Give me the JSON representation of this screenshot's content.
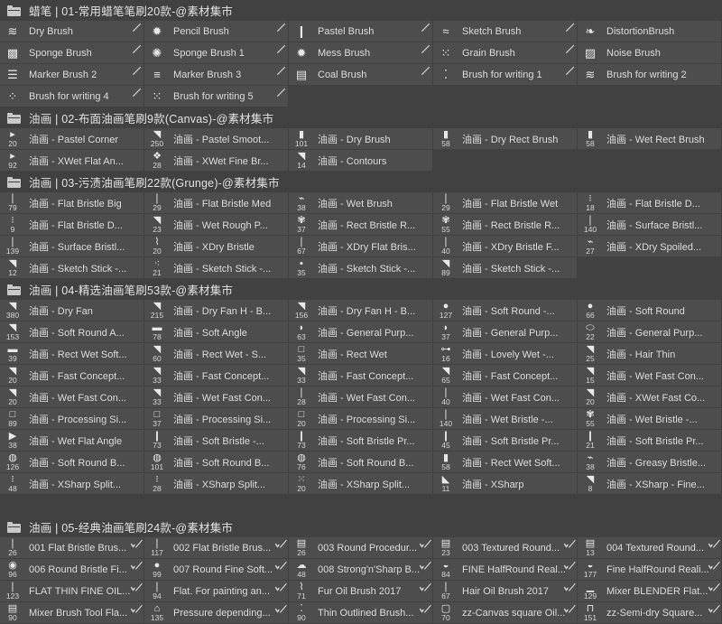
{
  "panel": {
    "title": "Brush Presets Panel",
    "background_color": "#414141",
    "item_color": "#4d4d4d",
    "text_color": "#dcdcdc"
  },
  "groups": [
    {
      "name": "group-crayon",
      "header": "蜡笔 | 01-常用蜡笔笔刷20款-@素材集市",
      "icon": "folder-icon",
      "thumb_style": "big",
      "items": [
        {
          "label": "Dry Brush",
          "glyph": "≋",
          "size": "",
          "corner": "pencil"
        },
        {
          "label": "Pencil Brush",
          "glyph": "✹",
          "size": "",
          "corner": "pencil"
        },
        {
          "label": "Pastel Brush",
          "glyph": "❙",
          "size": "",
          "corner": "pencil"
        },
        {
          "label": "Sketch Brush",
          "glyph": "≈",
          "size": "",
          "corner": "pencil"
        },
        {
          "label": "DistortionBrush",
          "glyph": "❧",
          "size": "",
          "corner": "none"
        },
        {
          "label": "Sponge Brush",
          "glyph": "▩",
          "size": "",
          "corner": "pencil"
        },
        {
          "label": "Sponge Brush 1",
          "glyph": "✺",
          "size": "",
          "corner": "pencil"
        },
        {
          "label": "Mess Brush",
          "glyph": "✹",
          "size": "",
          "corner": "pencil"
        },
        {
          "label": "Grain Brush",
          "glyph": "⁙",
          "size": "",
          "corner": "pencil"
        },
        {
          "label": "Noise Brush",
          "glyph": "▨",
          "size": "",
          "corner": "none"
        },
        {
          "label": "Marker Brush 2",
          "glyph": "☰",
          "size": "",
          "corner": "pencil"
        },
        {
          "label": "Marker Brush 3",
          "glyph": "≡",
          "size": "",
          "corner": "pencil"
        },
        {
          "label": "Coal Brush",
          "glyph": "▤",
          "size": "",
          "corner": "pencil"
        },
        {
          "label": "Brush for writing 1",
          "glyph": "⁚",
          "size": "",
          "corner": "pencil"
        },
        {
          "label": "Brush for writing 2",
          "glyph": "≋",
          "size": "",
          "corner": "none"
        },
        {
          "label": "Brush for writing 4",
          "glyph": "⁘",
          "size": "",
          "corner": "pencil"
        },
        {
          "label": "Brush for writing 5",
          "glyph": "⁙",
          "size": "",
          "corner": "pencil"
        },
        {
          "label": "",
          "glyph": "",
          "size": "",
          "corner": "none",
          "empty": true
        },
        {
          "label": "",
          "glyph": "",
          "size": "",
          "corner": "none",
          "empty": true
        },
        {
          "label": "",
          "glyph": "",
          "size": "",
          "corner": "none",
          "empty": true
        }
      ]
    },
    {
      "name": "group-canvas-oil",
      "header": "油画 | 02-布面油画笔刷9款(Canvas)-@素材集市",
      "icon": "folder-icon",
      "thumb_style": "small",
      "items": [
        {
          "label": "油画 - Pastel Corner",
          "glyph": "▸",
          "size": "20",
          "corner": "none"
        },
        {
          "label": "油画 - Pastel Smoot...",
          "glyph": "◥",
          "size": "250",
          "corner": "none"
        },
        {
          "label": "油画 - Dry Brush",
          "glyph": "▮",
          "size": "101",
          "corner": "none"
        },
        {
          "label": "油画 - Dry Rect Brush",
          "glyph": "▮",
          "size": "58",
          "corner": "none"
        },
        {
          "label": "油画 - Wet Rect Brush",
          "glyph": "▮",
          "size": "58",
          "corner": "none"
        },
        {
          "label": "油画 - XWet Flat An...",
          "glyph": "▸",
          "size": "92",
          "corner": "none"
        },
        {
          "label": "油画 - XWet Fine Br...",
          "glyph": "❖",
          "size": "28",
          "corner": "none"
        },
        {
          "label": "油画 - Contours",
          "glyph": "◥",
          "size": "14",
          "corner": "none"
        },
        {
          "label": "",
          "glyph": "",
          "size": "",
          "corner": "none",
          "empty": true
        },
        {
          "label": "",
          "glyph": "",
          "size": "",
          "corner": "none",
          "empty": true
        }
      ]
    },
    {
      "name": "group-grunge-oil",
      "header": "油画 | 03-污渍油画笔刷22款(Grunge)-@素材集市",
      "icon": "folder-icon",
      "thumb_style": "small",
      "items": [
        {
          "label": "油画 - Flat Bristle Big",
          "glyph": "❘",
          "size": "79",
          "corner": "none"
        },
        {
          "label": "油画 - Flat Bristle Med",
          "glyph": "❘",
          "size": "29",
          "corner": "none"
        },
        {
          "label": "油画 - Wet Brush",
          "glyph": "⌁",
          "size": "38",
          "corner": "none"
        },
        {
          "label": "油画 - Flat Bristle Wet",
          "glyph": "❘",
          "size": "29",
          "corner": "none"
        },
        {
          "label": "油画 - Flat Bristle D...",
          "glyph": "⁝",
          "size": "18",
          "corner": "none"
        },
        {
          "label": "油画 - Flat Bristle D...",
          "glyph": "⁝",
          "size": "9",
          "corner": "none"
        },
        {
          "label": "油画 - Wet Rough P...",
          "glyph": "◥",
          "size": "23",
          "corner": "none"
        },
        {
          "label": "油画 - Rect Bristle R...",
          "glyph": "✾",
          "size": "37",
          "corner": "none"
        },
        {
          "label": "油画 - Rect Bristle R...",
          "glyph": "✾",
          "size": "55",
          "corner": "none"
        },
        {
          "label": "油画 - Surface Bristl...",
          "glyph": "❘",
          "size": "140",
          "corner": "none"
        },
        {
          "label": "油画 - Surface Bristl...",
          "glyph": "❘",
          "size": "139",
          "corner": "none"
        },
        {
          "label": "油画 - XDry Bristle",
          "glyph": "⌇",
          "size": "20",
          "corner": "none"
        },
        {
          "label": "油画 - XDry Flat Bris...",
          "glyph": "❘",
          "size": "67",
          "corner": "none"
        },
        {
          "label": "油画 - XDry Bristle F...",
          "glyph": "❘",
          "size": "40",
          "corner": "none"
        },
        {
          "label": "油画 - XDry Spoiled...",
          "glyph": "⌁",
          "size": "27",
          "corner": "none"
        },
        {
          "label": "油画 - Sketch Stick -...",
          "glyph": "◥",
          "size": "12",
          "corner": "none"
        },
        {
          "label": "油画 - Sketch Stick -...",
          "glyph": "⁖",
          "size": "21",
          "corner": "none"
        },
        {
          "label": "油画 - Sketch Stick -...",
          "glyph": "▪",
          "size": "35",
          "corner": "none"
        },
        {
          "label": "油画 - Sketch Stick -...",
          "glyph": "◥",
          "size": "89",
          "corner": "none"
        },
        {
          "label": "",
          "glyph": "",
          "size": "",
          "corner": "none",
          "empty": true
        }
      ]
    },
    {
      "name": "group-selected-oil",
      "header": "油画 | 04-精选油画笔刷53款-@素材集市",
      "icon": "folder-icon",
      "thumb_style": "small",
      "items": [
        {
          "label": "油画 - Dry Fan",
          "glyph": "◥",
          "size": "380",
          "corner": "none"
        },
        {
          "label": "油画 - Dry Fan H - B...",
          "glyph": "◥",
          "size": "215",
          "corner": "none"
        },
        {
          "label": "油画 - Dry Fan H - B...",
          "glyph": "◥",
          "size": "156",
          "corner": "none"
        },
        {
          "label": "油画 - Soft Round -...",
          "glyph": "●",
          "size": "127",
          "corner": "none"
        },
        {
          "label": "油画 - Soft Round",
          "glyph": "●",
          "size": "66",
          "corner": "none"
        },
        {
          "label": "油画 - Soft Round A...",
          "glyph": "◥",
          "size": "153",
          "corner": "none"
        },
        {
          "label": "油画 - Soft Angle",
          "glyph": "▬",
          "size": "78",
          "corner": "none"
        },
        {
          "label": "油画 - General Purp...",
          "glyph": "◗",
          "size": "63",
          "corner": "none"
        },
        {
          "label": "油画 - General Purp...",
          "glyph": "◗",
          "size": "37",
          "corner": "none"
        },
        {
          "label": "油画 - General Purp...",
          "glyph": "⬭",
          "size": "22",
          "corner": "none"
        },
        {
          "label": "油画 - Rect Wet Soft...",
          "glyph": "▬",
          "size": "39",
          "corner": "none"
        },
        {
          "label": "油画 - Rect Wet - S...",
          "glyph": "◥",
          "size": "60",
          "corner": "none"
        },
        {
          "label": "油画 - Rect Wet",
          "glyph": "□",
          "size": "35",
          "corner": "none"
        },
        {
          "label": "油画 - Lovely Wet -...",
          "glyph": "⊶",
          "size": "16",
          "corner": "none"
        },
        {
          "label": "油画 - Hair Thin",
          "glyph": "◥",
          "size": "25",
          "corner": "none"
        },
        {
          "label": "油画 - Fast Concept...",
          "glyph": "◥",
          "size": "20",
          "corner": "none"
        },
        {
          "label": "油画 - Fast Concept...",
          "glyph": "◥",
          "size": "33",
          "corner": "none"
        },
        {
          "label": "油画 - Fast Concept...",
          "glyph": "◥",
          "size": "33",
          "corner": "none"
        },
        {
          "label": "油画 - Fast Concept...",
          "glyph": "◥",
          "size": "65",
          "corner": "none"
        },
        {
          "label": "油画 - Wet Fast Con...",
          "glyph": "◥",
          "size": "15",
          "corner": "none"
        },
        {
          "label": "油画 - Wet Fast Con...",
          "glyph": "◥",
          "size": "20",
          "corner": "none"
        },
        {
          "label": "油画 - Wet Fast Con...",
          "glyph": "◥",
          "size": "33",
          "corner": "none"
        },
        {
          "label": "油画 - Wet Fast Con...",
          "glyph": "❘",
          "size": "28",
          "corner": "none"
        },
        {
          "label": "油画 - Wet Fast Con...",
          "glyph": "❘",
          "size": "40",
          "corner": "none"
        },
        {
          "label": "油画 - XWet Fast Co...",
          "glyph": "◥",
          "size": "20",
          "corner": "none"
        },
        {
          "label": "油画 - Processing Si...",
          "glyph": "□",
          "size": "89",
          "corner": "none"
        },
        {
          "label": "油画 - Processing Si...",
          "glyph": "□",
          "size": "37",
          "corner": "none"
        },
        {
          "label": "油画 - Processing Si...",
          "glyph": "□",
          "size": "20",
          "corner": "none"
        },
        {
          "label": "油画 - Wet Bristle -...",
          "glyph": "❘",
          "size": "140",
          "corner": "none"
        },
        {
          "label": "油画 - Wet Bristle -...",
          "glyph": "✾",
          "size": "55",
          "corner": "none"
        },
        {
          "label": "油画 - Wet Flat Angle",
          "glyph": "▶",
          "size": "38",
          "corner": "none"
        },
        {
          "label": "油画 - Soft Bristle -...",
          "glyph": "❙",
          "size": "73",
          "corner": "none"
        },
        {
          "label": "油画 - Soft Bristle Pr...",
          "glyph": "❙",
          "size": "73",
          "corner": "none"
        },
        {
          "label": "油画 - Soft Bristle Pr...",
          "glyph": "❙",
          "size": "45",
          "corner": "none"
        },
        {
          "label": "油画 - Soft Bristle Pr...",
          "glyph": "❙",
          "size": "21",
          "corner": "none"
        },
        {
          "label": "油画 - Soft Round B...",
          "glyph": "◍",
          "size": "126",
          "corner": "none"
        },
        {
          "label": "油画 - Soft Round B...",
          "glyph": "◍",
          "size": "101",
          "corner": "none"
        },
        {
          "label": "油画 - Soft Round B...",
          "glyph": "◍",
          "size": "76",
          "corner": "none"
        },
        {
          "label": "油画 - Rect Wet Soft...",
          "glyph": "▮",
          "size": "58",
          "corner": "none"
        },
        {
          "label": "油画 - Greasy Bristle...",
          "glyph": "⌁",
          "size": "38",
          "corner": "none"
        },
        {
          "label": "油画 - XSharp Split...",
          "glyph": "⁝",
          "size": "48",
          "corner": "none"
        },
        {
          "label": "油画 - XSharp Split...",
          "glyph": "⁝",
          "size": "28",
          "corner": "none"
        },
        {
          "label": "油画 - XSharp Split...",
          "glyph": "⁙",
          "size": "20",
          "corner": "none"
        },
        {
          "label": "油画 - XSharp",
          "glyph": "◣",
          "size": "11",
          "corner": "none"
        },
        {
          "label": "油画 - XSharp - Fine...",
          "glyph": "◥",
          "size": "8",
          "corner": "none"
        },
        {
          "label": "",
          "glyph": "",
          "size": "",
          "corner": "none",
          "empty": true
        },
        {
          "label": "",
          "glyph": "",
          "size": "",
          "corner": "none",
          "empty": true
        },
        {
          "label": "",
          "glyph": "",
          "size": "",
          "corner": "none",
          "empty": true
        },
        {
          "label": "",
          "glyph": "",
          "size": "",
          "corner": "none",
          "empty": true
        },
        {
          "label": "",
          "glyph": "",
          "size": "",
          "corner": "none",
          "empty": true
        }
      ]
    },
    {
      "name": "group-classic-oil",
      "header": "油画 | 05-经典油画笔刷24款-@素材集市",
      "icon": "folder-icon",
      "thumb_style": "small",
      "items": [
        {
          "label": "001 Flat Bristle Brus...",
          "glyph": "❘",
          "size": "26",
          "corner": "toolpreset"
        },
        {
          "label": "002 Flat Bristle Brus...",
          "glyph": "❘",
          "size": "117",
          "corner": "toolpreset"
        },
        {
          "label": "003 Round Procedur...",
          "glyph": "▤",
          "size": "26",
          "corner": "toolpreset"
        },
        {
          "label": "003 Textured Round...",
          "glyph": "▤",
          "size": "23",
          "corner": "toolpreset"
        },
        {
          "label": "004 Textured Round...",
          "glyph": "▤",
          "size": "13",
          "corner": "toolpreset"
        },
        {
          "label": "006 Round Bristle Fi...",
          "glyph": "◉",
          "size": "96",
          "corner": "toolpreset"
        },
        {
          "label": "007 Round Fine Soft...",
          "glyph": "●",
          "size": "99",
          "corner": "toolpreset"
        },
        {
          "label": "008 Strong'n'Sharp B...",
          "glyph": "☁",
          "size": "48",
          "corner": "toolpreset"
        },
        {
          "label": "FINE HalfRound Real...",
          "glyph": "◒",
          "size": "84",
          "corner": "toolpreset"
        },
        {
          "label": "Fine HalfRound Reali...",
          "glyph": "◒",
          "size": "177",
          "corner": "toolpreset"
        },
        {
          "label": "FLAT THIN FINE OIL...",
          "glyph": "❘",
          "size": "123",
          "corner": "toolpreset"
        },
        {
          "label": "Flat. For painting an...",
          "glyph": "❘",
          "size": "94",
          "corner": "toolpreset"
        },
        {
          "label": "Fur Oil Brush 2017",
          "glyph": "⌇",
          "size": "71",
          "corner": "toolpreset"
        },
        {
          "label": "Hair Oil Brush 2017",
          "glyph": "❘",
          "size": "67",
          "corner": "toolpreset"
        },
        {
          "label": "Mixer BLENDER Flat...",
          "glyph": "▁",
          "size": "129",
          "corner": "toolpreset"
        },
        {
          "label": "Mixer Brush Tool Fla...",
          "glyph": "▤",
          "size": "90",
          "corner": "toolpreset"
        },
        {
          "label": "Pressure depending...",
          "glyph": "⌂",
          "size": "135",
          "corner": "toolpreset"
        },
        {
          "label": "Thin Outlined Brush...",
          "glyph": "⁚",
          "size": "90",
          "corner": "toolpreset"
        },
        {
          "label": "zz-Canvas square Oil...",
          "glyph": "▢",
          "size": "70",
          "corner": "toolpreset"
        },
        {
          "label": "zz-Semi-dry Square...",
          "glyph": "⊓",
          "size": "151",
          "corner": "toolpreset"
        }
      ]
    }
  ]
}
